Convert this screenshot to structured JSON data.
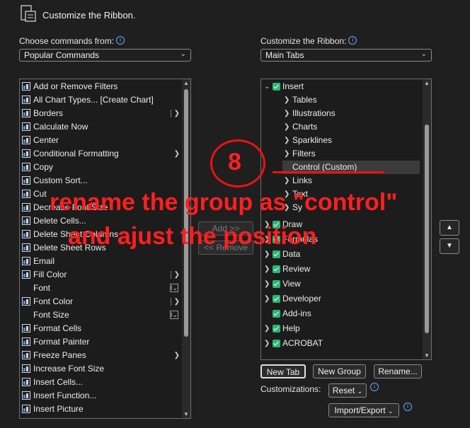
{
  "header": {
    "title": "Customize the Ribbon."
  },
  "left": {
    "label": "Choose commands from:",
    "combo_value": "Popular Commands",
    "items": [
      {
        "label": "Add or Remove Filters",
        "icon": "filter-icon",
        "sub": ""
      },
      {
        "label": "All Chart Types... [Create Chart]",
        "icon": "chart-icon",
        "sub": ""
      },
      {
        "label": "Borders",
        "icon": "borders-icon",
        "sub": "split"
      },
      {
        "label": "Calculate Now",
        "icon": "calculator-icon",
        "sub": ""
      },
      {
        "label": "Center",
        "icon": "center-align-icon",
        "sub": ""
      },
      {
        "label": "Conditional Formatting",
        "icon": "conditional-formatting-icon",
        "sub": "arrow"
      },
      {
        "label": "Copy",
        "icon": "copy-icon",
        "sub": ""
      },
      {
        "label": "Custom Sort...",
        "icon": "sort-icon",
        "sub": ""
      },
      {
        "label": "Cut",
        "icon": "scissors-icon",
        "sub": ""
      },
      {
        "label": "Decrease Font Size",
        "icon": "decrease-font-icon",
        "sub": ""
      },
      {
        "label": "Delete Cells...",
        "icon": "delete-cells-icon",
        "sub": ""
      },
      {
        "label": "Delete Sheet Columns",
        "icon": "delete-columns-icon",
        "sub": ""
      },
      {
        "label": "Delete Sheet Rows",
        "icon": "delete-rows-icon",
        "sub": ""
      },
      {
        "label": "Email",
        "icon": "email-icon",
        "sub": ""
      },
      {
        "label": "Fill Color",
        "icon": "fill-color-icon",
        "sub": "split"
      },
      {
        "label": "Font",
        "icon": "",
        "sub": "box"
      },
      {
        "label": "Font Color",
        "icon": "font-color-icon",
        "sub": "split"
      },
      {
        "label": "Font Size",
        "icon": "",
        "sub": "box"
      },
      {
        "label": "Format Cells",
        "icon": "format-cells-icon",
        "sub": ""
      },
      {
        "label": "Format Painter",
        "icon": "format-painter-icon",
        "sub": ""
      },
      {
        "label": "Freeze Panes",
        "icon": "freeze-panes-icon",
        "sub": "arrow"
      },
      {
        "label": "Increase Font Size",
        "icon": "increase-font-icon",
        "sub": ""
      },
      {
        "label": "Insert Cells...",
        "icon": "insert-cells-icon",
        "sub": ""
      },
      {
        "label": "Insert Function...",
        "icon": "function-icon",
        "sub": ""
      },
      {
        "label": "Insert Picture",
        "icon": "picture-icon",
        "sub": ""
      }
    ]
  },
  "middle": {
    "add_label": "Add >>",
    "remove_label": "<< Remove"
  },
  "right": {
    "label": "Customize the Ribbon:",
    "combo_value": "Main Tabs",
    "tree": [
      {
        "label": "Insert",
        "level": 0,
        "checked": true,
        "expanded": true
      },
      {
        "label": "Tables",
        "level": 1
      },
      {
        "label": "Illustrations",
        "level": 1
      },
      {
        "label": "Charts",
        "level": 1
      },
      {
        "label": "Sparklines",
        "level": 1
      },
      {
        "label": "Filters",
        "level": 1
      },
      {
        "label": "Control (Custom)",
        "level": 1,
        "selected": true,
        "noarrow": true
      },
      {
        "label": "Links",
        "level": 1
      },
      {
        "label": "Text",
        "level": 1
      },
      {
        "label": "Sy",
        "level": 1
      },
      {
        "label": "Draw",
        "level": 0,
        "checked": true
      },
      {
        "label": "Formulas",
        "level": 0,
        "checked": true
      },
      {
        "label": "Data",
        "level": 0,
        "checked": true
      },
      {
        "label": "Review",
        "level": 0,
        "checked": true
      },
      {
        "label": "View",
        "level": 0,
        "checked": true
      },
      {
        "label": "Developer",
        "level": 0,
        "checked": true
      },
      {
        "label": "Add-ins",
        "level": 0,
        "checked": true,
        "noarrow": true
      },
      {
        "label": "Help",
        "level": 0,
        "checked": true
      },
      {
        "label": "ACROBAT",
        "level": 0,
        "checked": true
      }
    ],
    "new_tab": "New Tab",
    "new_group": "New Group",
    "rename": "Rename...",
    "customizations_label": "Customizations:",
    "reset": "Reset",
    "import_export": "Import/Export"
  },
  "annotation": {
    "step": "8",
    "line1": "rename the group as \"control\"",
    "line2": "and ajust the position"
  }
}
